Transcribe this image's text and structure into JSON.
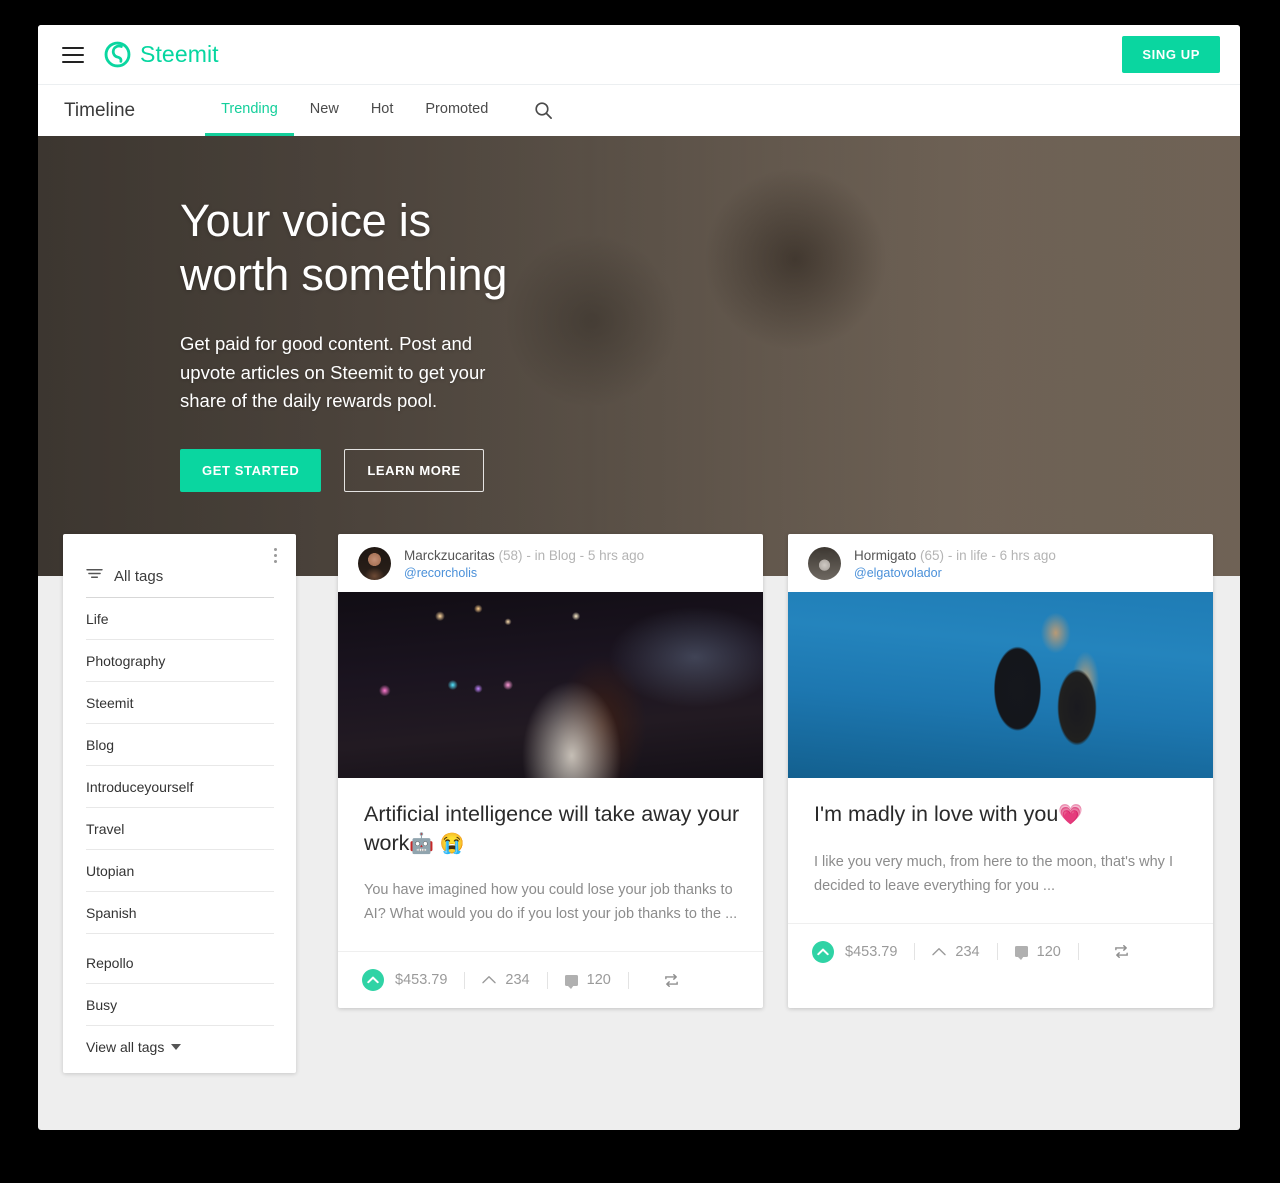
{
  "header": {
    "menu_icon": "hamburger-icon",
    "logo_icon": "steemit-logo-icon",
    "brand": "Steemit",
    "signup_label": "SING UP"
  },
  "nav": {
    "title": "Timeline",
    "tabs": [
      {
        "label": "Trending",
        "active": true
      },
      {
        "label": "New",
        "active": false
      },
      {
        "label": "Hot",
        "active": false
      },
      {
        "label": "Promoted",
        "active": false
      }
    ],
    "search_icon": "search-icon"
  },
  "hero": {
    "title_line1": "Your voice is",
    "title_line2": "worth something",
    "subtitle": "Get paid for good content. Post and upvote articles on Steemit to get your share of the daily rewards pool.",
    "primary_button": "GET STARTED",
    "secondary_button": "LEARN MORE"
  },
  "sidebar": {
    "kebab_icon": "more-vertical-icon",
    "filter_icon": "filter-icon",
    "all_tags_label": "All tags",
    "tags": [
      "Life",
      "Photography",
      "Steemit",
      "Blog",
      "Introduceyourself",
      "Travel",
      "Utopian",
      "Spanish",
      "Repollo",
      "Busy"
    ],
    "view_all_label": "View all tags",
    "caret_icon": "chevron-down-icon"
  },
  "posts": [
    {
      "avatar": "avatar-marckzucaritas",
      "author": "Marckzucaritas",
      "reputation": "(58)",
      "meta": "- in Blog - 5 hrs ago",
      "handle": "@recorcholis",
      "image": "post-image-night-city-laptop",
      "title": "Artificial intelligence will take away your work",
      "title_emojis": "🤖 😭",
      "excerpt": "You have imagined how you could lose your job thanks to AI? What would you do if you lost your job thanks to the ...",
      "payout": "$453.79",
      "votes": "234",
      "comments": "120",
      "upvote_icon": "upvote-icon",
      "votes_icon": "chevron-up-icon",
      "comment_icon": "comment-icon",
      "resteem_icon": "resteem-icon"
    },
    {
      "avatar": "avatar-hormigato",
      "author": "Hormigato",
      "reputation": "(65)",
      "meta": "- in life - 6 hrs ago",
      "handle": "@elgatovolador",
      "image": "post-image-couple-blue-sky",
      "title": "I'm madly in love with you",
      "title_emojis": "💗",
      "excerpt": "I like you very much, from here to the moon, that's why I decided to leave everything for you ...",
      "payout": "$453.79",
      "votes": "234",
      "comments": "120",
      "upvote_icon": "upvote-icon",
      "votes_icon": "chevron-up-icon",
      "comment_icon": "comment-icon",
      "resteem_icon": "resteem-icon"
    }
  ],
  "colors": {
    "accent": "#0ad6a0",
    "accent_upvote": "#2fd3a5",
    "link": "#4a90d9",
    "text": "#333333",
    "muted": "#9a9a9a",
    "page_bg": "#eeeeee",
    "outer_bg": "#000000"
  }
}
